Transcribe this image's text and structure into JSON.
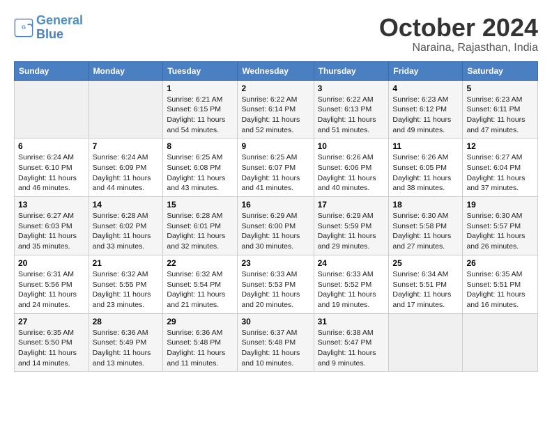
{
  "header": {
    "logo_line1": "General",
    "logo_line2": "Blue",
    "title": "October 2024",
    "subtitle": "Naraina, Rajasthan, India"
  },
  "days_of_week": [
    "Sunday",
    "Monday",
    "Tuesday",
    "Wednesday",
    "Thursday",
    "Friday",
    "Saturday"
  ],
  "weeks": [
    [
      {
        "num": "",
        "info": ""
      },
      {
        "num": "",
        "info": ""
      },
      {
        "num": "1",
        "info": "Sunrise: 6:21 AM\nSunset: 6:15 PM\nDaylight: 11 hours and 54 minutes."
      },
      {
        "num": "2",
        "info": "Sunrise: 6:22 AM\nSunset: 6:14 PM\nDaylight: 11 hours and 52 minutes."
      },
      {
        "num": "3",
        "info": "Sunrise: 6:22 AM\nSunset: 6:13 PM\nDaylight: 11 hours and 51 minutes."
      },
      {
        "num": "4",
        "info": "Sunrise: 6:23 AM\nSunset: 6:12 PM\nDaylight: 11 hours and 49 minutes."
      },
      {
        "num": "5",
        "info": "Sunrise: 6:23 AM\nSunset: 6:11 PM\nDaylight: 11 hours and 47 minutes."
      }
    ],
    [
      {
        "num": "6",
        "info": "Sunrise: 6:24 AM\nSunset: 6:10 PM\nDaylight: 11 hours and 46 minutes."
      },
      {
        "num": "7",
        "info": "Sunrise: 6:24 AM\nSunset: 6:09 PM\nDaylight: 11 hours and 44 minutes."
      },
      {
        "num": "8",
        "info": "Sunrise: 6:25 AM\nSunset: 6:08 PM\nDaylight: 11 hours and 43 minutes."
      },
      {
        "num": "9",
        "info": "Sunrise: 6:25 AM\nSunset: 6:07 PM\nDaylight: 11 hours and 41 minutes."
      },
      {
        "num": "10",
        "info": "Sunrise: 6:26 AM\nSunset: 6:06 PM\nDaylight: 11 hours and 40 minutes."
      },
      {
        "num": "11",
        "info": "Sunrise: 6:26 AM\nSunset: 6:05 PM\nDaylight: 11 hours and 38 minutes."
      },
      {
        "num": "12",
        "info": "Sunrise: 6:27 AM\nSunset: 6:04 PM\nDaylight: 11 hours and 37 minutes."
      }
    ],
    [
      {
        "num": "13",
        "info": "Sunrise: 6:27 AM\nSunset: 6:03 PM\nDaylight: 11 hours and 35 minutes."
      },
      {
        "num": "14",
        "info": "Sunrise: 6:28 AM\nSunset: 6:02 PM\nDaylight: 11 hours and 33 minutes."
      },
      {
        "num": "15",
        "info": "Sunrise: 6:28 AM\nSunset: 6:01 PM\nDaylight: 11 hours and 32 minutes."
      },
      {
        "num": "16",
        "info": "Sunrise: 6:29 AM\nSunset: 6:00 PM\nDaylight: 11 hours and 30 minutes."
      },
      {
        "num": "17",
        "info": "Sunrise: 6:29 AM\nSunset: 5:59 PM\nDaylight: 11 hours and 29 minutes."
      },
      {
        "num": "18",
        "info": "Sunrise: 6:30 AM\nSunset: 5:58 PM\nDaylight: 11 hours and 27 minutes."
      },
      {
        "num": "19",
        "info": "Sunrise: 6:30 AM\nSunset: 5:57 PM\nDaylight: 11 hours and 26 minutes."
      }
    ],
    [
      {
        "num": "20",
        "info": "Sunrise: 6:31 AM\nSunset: 5:56 PM\nDaylight: 11 hours and 24 minutes."
      },
      {
        "num": "21",
        "info": "Sunrise: 6:32 AM\nSunset: 5:55 PM\nDaylight: 11 hours and 23 minutes."
      },
      {
        "num": "22",
        "info": "Sunrise: 6:32 AM\nSunset: 5:54 PM\nDaylight: 11 hours and 21 minutes."
      },
      {
        "num": "23",
        "info": "Sunrise: 6:33 AM\nSunset: 5:53 PM\nDaylight: 11 hours and 20 minutes."
      },
      {
        "num": "24",
        "info": "Sunrise: 6:33 AM\nSunset: 5:52 PM\nDaylight: 11 hours and 19 minutes."
      },
      {
        "num": "25",
        "info": "Sunrise: 6:34 AM\nSunset: 5:51 PM\nDaylight: 11 hours and 17 minutes."
      },
      {
        "num": "26",
        "info": "Sunrise: 6:35 AM\nSunset: 5:51 PM\nDaylight: 11 hours and 16 minutes."
      }
    ],
    [
      {
        "num": "27",
        "info": "Sunrise: 6:35 AM\nSunset: 5:50 PM\nDaylight: 11 hours and 14 minutes."
      },
      {
        "num": "28",
        "info": "Sunrise: 6:36 AM\nSunset: 5:49 PM\nDaylight: 11 hours and 13 minutes."
      },
      {
        "num": "29",
        "info": "Sunrise: 6:36 AM\nSunset: 5:48 PM\nDaylight: 11 hours and 11 minutes."
      },
      {
        "num": "30",
        "info": "Sunrise: 6:37 AM\nSunset: 5:48 PM\nDaylight: 11 hours and 10 minutes."
      },
      {
        "num": "31",
        "info": "Sunrise: 6:38 AM\nSunset: 5:47 PM\nDaylight: 11 hours and 9 minutes."
      },
      {
        "num": "",
        "info": ""
      },
      {
        "num": "",
        "info": ""
      }
    ]
  ]
}
